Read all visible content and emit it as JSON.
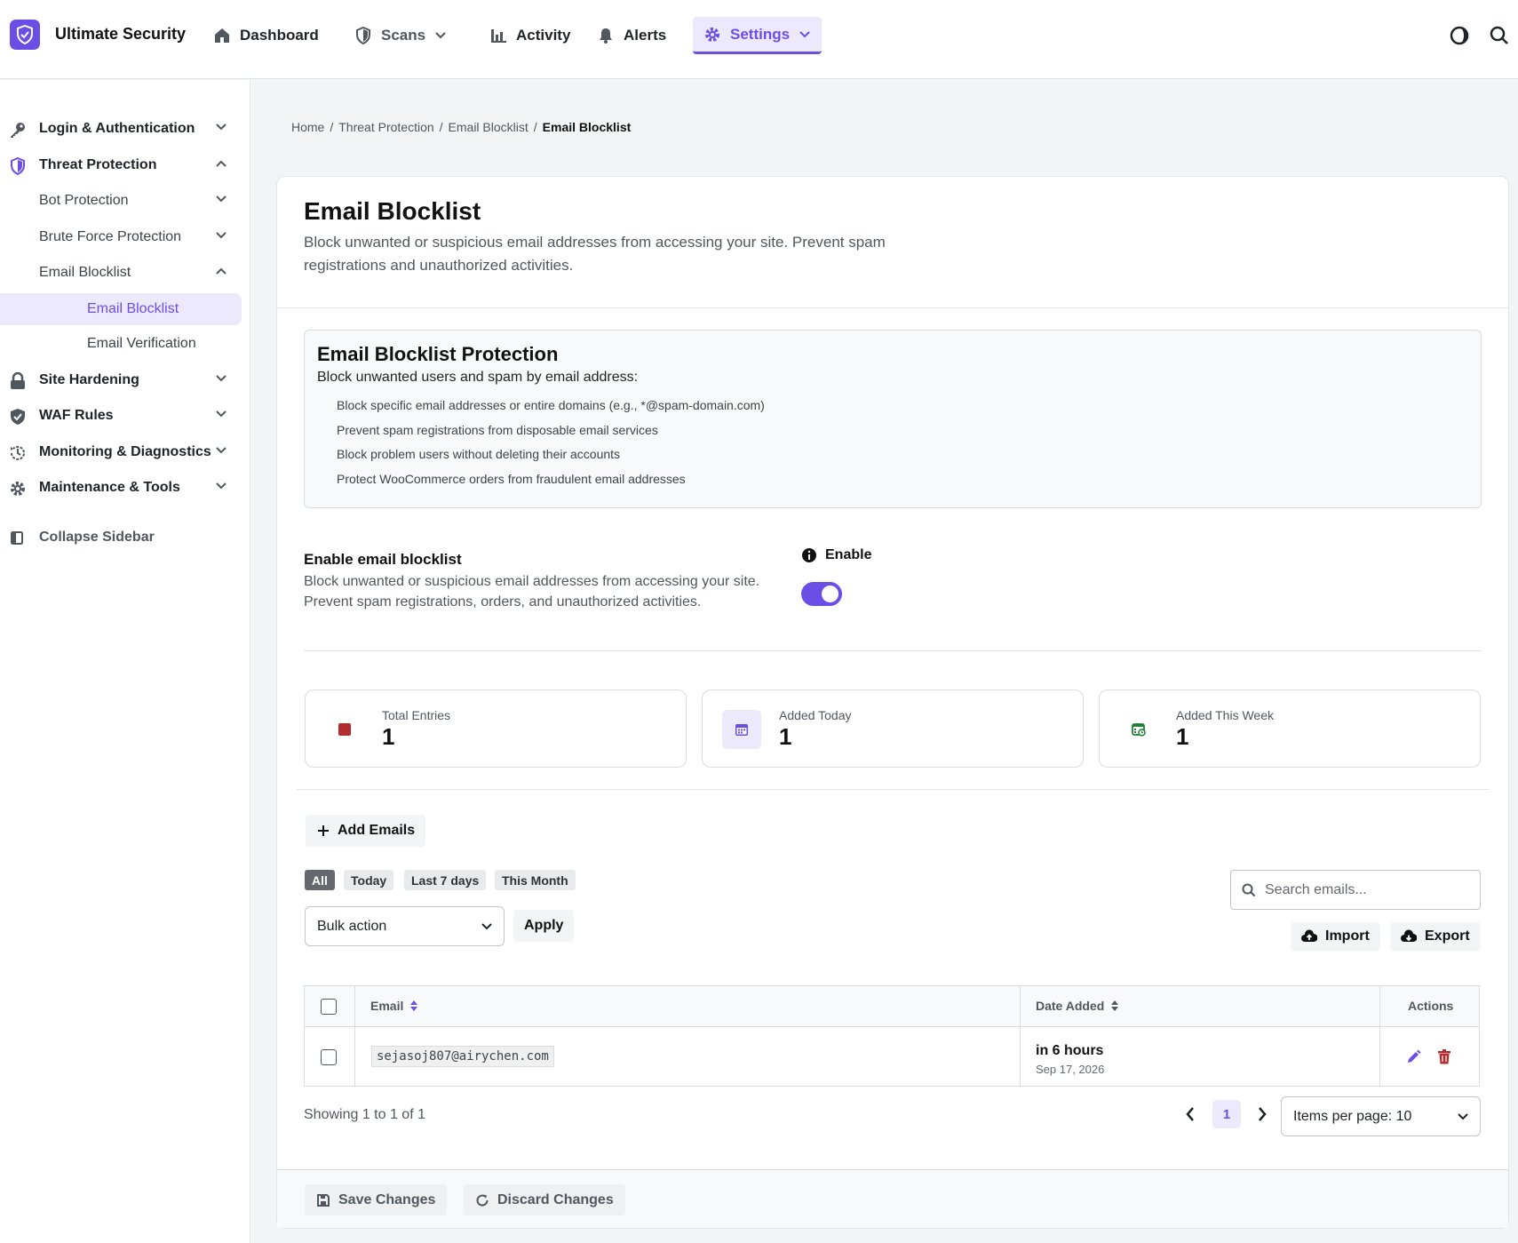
{
  "colors": {
    "accent": "#6b4ee6",
    "accent_soft": "#ede9fd",
    "danger": "#b32d2e",
    "success": "#1e7e34"
  },
  "topbar": {
    "brand": "Ultimate Security",
    "nav": [
      {
        "label": "Dashboard",
        "icon": "home-icon"
      },
      {
        "label": "Scans",
        "icon": "shield-icon"
      },
      {
        "label": "Activity",
        "icon": "bar-chart-icon"
      },
      {
        "label": "Alerts",
        "icon": "bell-icon"
      },
      {
        "label": "Settings",
        "icon": "gear-icon",
        "active": true
      }
    ],
    "right_icons": [
      "theme-toggle-icon",
      "search-icon"
    ]
  },
  "sidebar": {
    "items": [
      {
        "label": "Login & Authentication",
        "icon": "key-icon"
      },
      {
        "label": "Threat Protection",
        "icon": "shield-icon",
        "expanded": true
      },
      {
        "label": "Bot Protection"
      },
      {
        "label": "Brute Force Protection"
      },
      {
        "label": "Email Blocklist",
        "expanded": true
      },
      {
        "label": "Email Blocklist",
        "selected": true
      },
      {
        "label": "Email Verification"
      },
      {
        "label": "Site Hardening",
        "icon": "lock-icon"
      },
      {
        "label": "WAF Rules",
        "icon": "shield-check-icon"
      },
      {
        "label": "Monitoring & Diagnostics",
        "icon": "history-icon"
      },
      {
        "label": "Maintenance & Tools",
        "icon": "gear-icon"
      }
    ],
    "collapse_label": "Collapse Sidebar"
  },
  "breadcrumb": [
    "Home",
    "Threat Protection",
    "Email Blocklist",
    "Email Blocklist"
  ],
  "page": {
    "title": "Email Blocklist",
    "description": "Block unwanted or suspicious email addresses from accessing your site. Prevent spam registrations and unauthorized activities."
  },
  "info": {
    "title": "Email Blocklist Protection",
    "subtitle": "Block unwanted users and spam by email address:",
    "items": [
      "Block specific email addresses or entire domains (e.g., *@spam-domain.com)",
      "Prevent spam registrations from disposable email services",
      "Block problem users without deleting their accounts",
      "Protect WooCommerce orders from fraudulent email addresses"
    ]
  },
  "setting": {
    "title": "Enable email blocklist",
    "description": "Block unwanted or suspicious email addresses from accessing your site. Prevent spam registrations, orders, and unauthorized activities.",
    "enable_label": "Enable",
    "enabled": true
  },
  "stats": [
    {
      "label": "Total Entries",
      "value": "1",
      "icon": "square-icon"
    },
    {
      "label": "Added Today",
      "value": "1",
      "icon": "calendar-icon"
    },
    {
      "label": "Added This Week",
      "value": "1",
      "icon": "calendar-week-icon"
    }
  ],
  "toolbar": {
    "add_label": "Add Emails",
    "filters": [
      "All",
      "Today",
      "Last 7 days",
      "This Month"
    ],
    "active_filter": "All",
    "search_placeholder": "Search emails...",
    "bulk_action": "Bulk action",
    "apply_label": "Apply",
    "import_label": "Import",
    "export_label": "Export"
  },
  "table": {
    "headers": {
      "email": "Email",
      "date": "Date Added",
      "actions": "Actions"
    },
    "rows": [
      {
        "email": "sejasoj807@airychen.com",
        "date_relative": "in 6 hours",
        "date": "Sep 17, 2026"
      }
    ]
  },
  "pagination": {
    "showing": "Showing 1 to 1 of 1",
    "current_page": "1",
    "per_page": "Items per page: 10"
  },
  "footer": {
    "save_label": "Save Changes",
    "discard_label": "Discard Changes"
  }
}
